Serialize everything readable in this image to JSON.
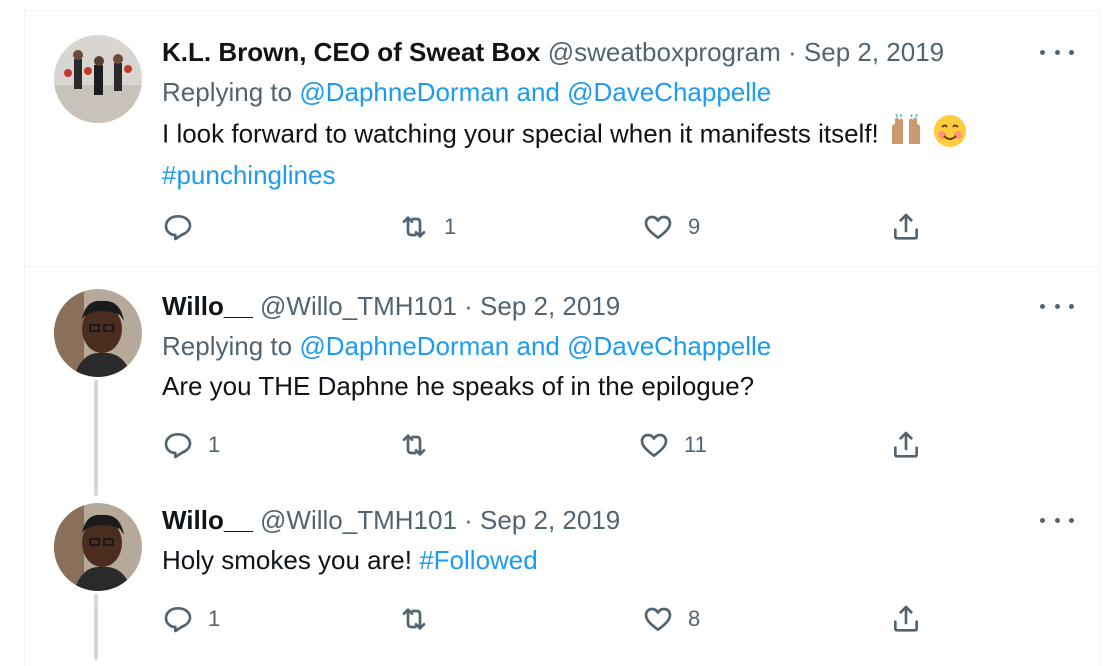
{
  "tweets": [
    {
      "name": "K.L. Brown, CEO of Sweat Box",
      "handle": "@sweatboxprogram",
      "date": "Sep 2, 2019",
      "replying_prefix": "Replying to ",
      "replying_to": "@DaphneDorman and @DaveChappelle",
      "text_main": "I look forward to watching your special when it manifests itself!",
      "hashtag": "#punchinglines",
      "reply_count": "",
      "retweet_count": "1",
      "like_count": "9"
    },
    {
      "name": "Willo__",
      "handle": "@Willo_TMH101",
      "date": "Sep 2, 2019",
      "replying_prefix": "Replying to ",
      "replying_to": "@DaphneDorman and @DaveChappelle",
      "text_main": "Are you THE Daphne he speaks of in the epilogue?",
      "reply_count": "1",
      "retweet_count": "",
      "like_count": "11"
    },
    {
      "name": "Willo__",
      "handle": "@Willo_TMH101",
      "date": "Sep 2, 2019",
      "text_main": "Holy smokes you are!",
      "hashtag": "#Followed",
      "reply_count": "1",
      "retweet_count": "",
      "like_count": "8"
    }
  ],
  "separator": " · ",
  "colors": {
    "link": "#1d9bf0",
    "secondary": "#536471",
    "text": "#0f1419",
    "border": "#eff3f4"
  },
  "icons": [
    "reply-icon",
    "retweet-icon",
    "like-icon",
    "share-icon",
    "more-icon",
    "raising-hands-emoji",
    "smiling-face-emoji"
  ]
}
